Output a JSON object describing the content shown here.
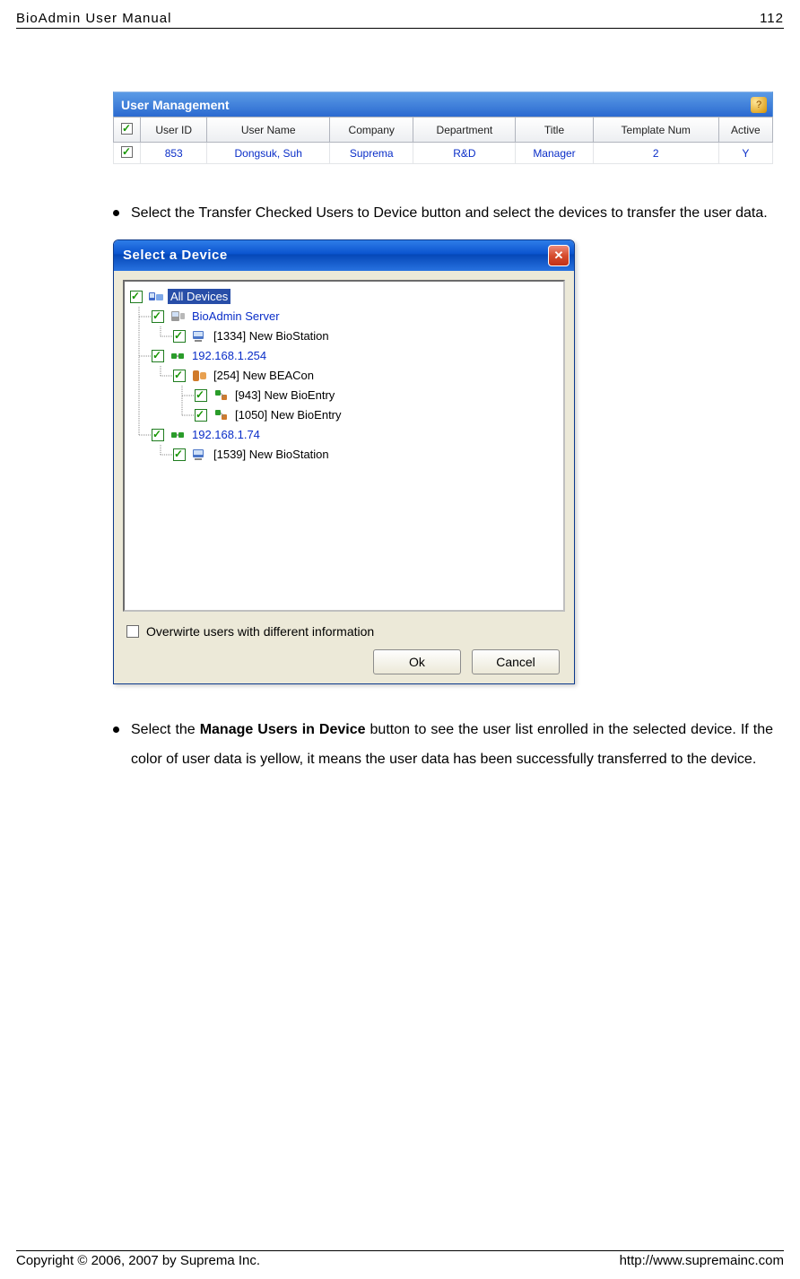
{
  "header": {
    "title": "BioAdmin User Manual",
    "page": "112"
  },
  "user_mgmt": {
    "title": "User Management",
    "columns": [
      "",
      "User ID",
      "User Name",
      "Company",
      "Department",
      "Title",
      "Template Num",
      "Active"
    ],
    "row": {
      "user_id": "853",
      "user_name": "Dongsuk, Suh",
      "company": "Suprema",
      "department": "R&D",
      "title": "Manager",
      "template_num": "2",
      "active": "Y"
    }
  },
  "bullet1": "Select the Transfer Checked Users to Device button and select the devices to transfer the user data.",
  "dialog": {
    "title": "Select a Device",
    "tree": {
      "root": "All Devices",
      "items": [
        "BioAdmin Server",
        "[1334] New BioStation",
        "192.168.1.254",
        "[254] New BEACon",
        "[943] New BioEntry",
        "[1050] New BioEntry",
        "192.168.1.74",
        "[1539] New BioStation"
      ]
    },
    "overwrite_label": "Overwirte users with different information",
    "ok_label": "Ok",
    "cancel_label": "Cancel"
  },
  "bullet2_prefix": "Select the ",
  "bullet2_bold": "Manage Users in Device",
  "bullet2_suffix": " button to see the user list enrolled in the selected device. If the color of user data is yellow, it means the user data has been successfully transferred to the device.",
  "footer": {
    "copyright": "Copyright © 2006, 2007 by Suprema Inc.",
    "url": "http://www.supremainc.com"
  }
}
